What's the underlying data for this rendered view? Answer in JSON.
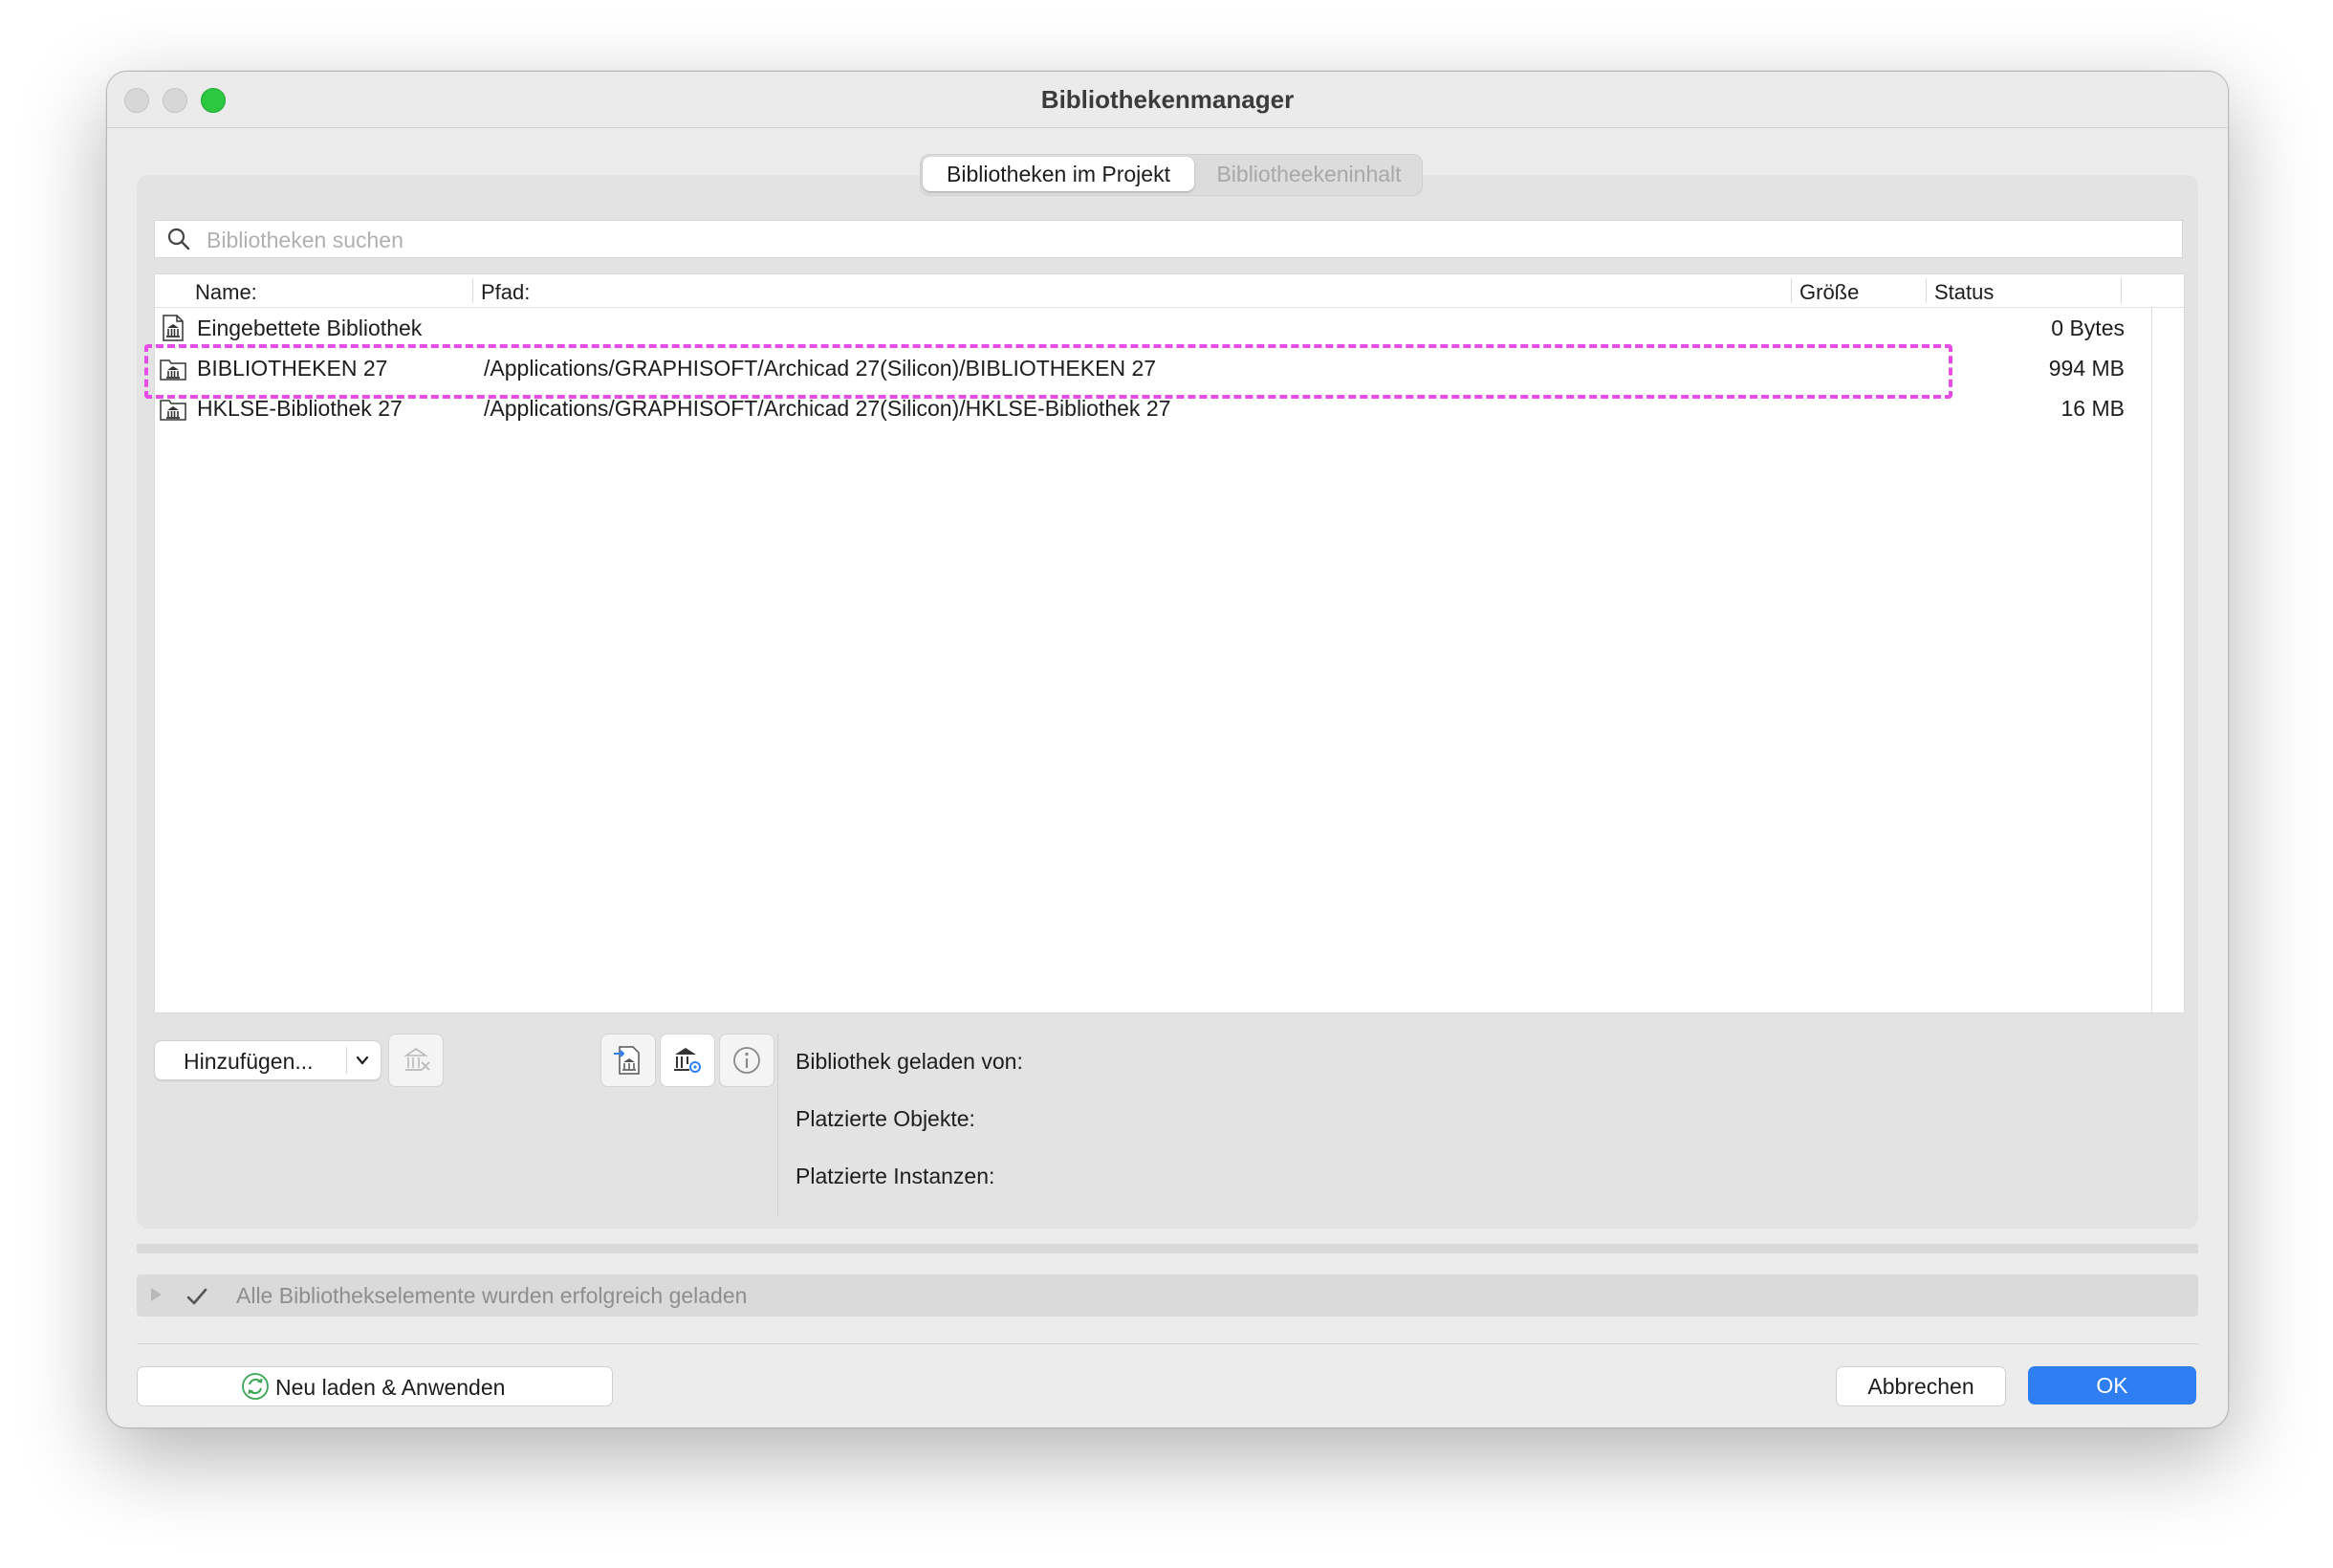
{
  "window": {
    "title": "Bibliothekenmanager"
  },
  "tabs": [
    {
      "label": "Bibliotheken im Projekt",
      "active": true
    },
    {
      "label": "Bibliotheekeninhalt",
      "active": false
    }
  ],
  "search": {
    "placeholder": "Bibliotheken suchen",
    "value": ""
  },
  "table": {
    "columns": {
      "name": "Name:",
      "path": "Pfad:",
      "size": "Größe",
      "status": "Status"
    },
    "rows": [
      {
        "icon": "embedded-library-icon",
        "name": "Eingebettete Bibliothek",
        "path": "",
        "size": "0 Bytes",
        "status": ""
      },
      {
        "icon": "linked-library-icon",
        "name": "BIBLIOTHEKEN 27",
        "path": "/Applications/GRAPHISOFT/Archicad 27(Silicon)/BIBLIOTHEKEN 27",
        "size": "994 MB",
        "status": "",
        "highlighted": true
      },
      {
        "icon": "linked-library-icon",
        "name": "HKLSE-Bibliothek 27",
        "path": "/Applications/GRAPHISOFT/Archicad 27(Silicon)/HKLSE-Bibliothek 27",
        "size": "16 MB",
        "status": ""
      }
    ]
  },
  "actions": {
    "add_label": "Hinzufügen...",
    "icons": [
      "remove-library-icon",
      "export-library-icon",
      "library-settings-icon",
      "info-icon"
    ]
  },
  "details": {
    "loaded_from": "Bibliothek geladen von:",
    "placed_objects": "Platzierte Objekte:",
    "placed_instances": "Platzierte Instanzen:"
  },
  "status": {
    "text": "Alle Bibliothekselemente wurden erfolgreich geladen"
  },
  "footer": {
    "reload_label": "Neu laden & Anwenden",
    "cancel_label": "Abbrechen",
    "ok_label": "OK"
  },
  "colors": {
    "accent": "#2f7ff2",
    "highlight": "#e64ce6",
    "reload_icon": "#3aa655"
  }
}
